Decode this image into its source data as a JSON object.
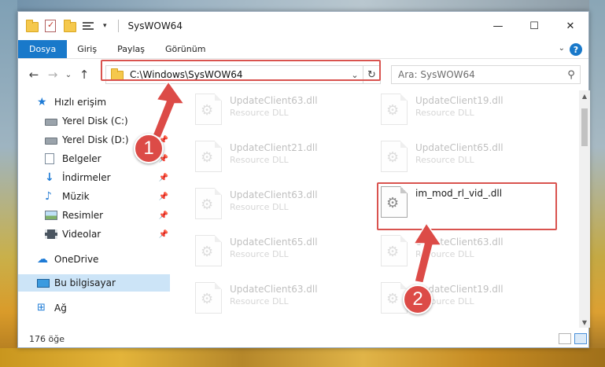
{
  "window": {
    "title": "SysWOW64",
    "controls": {
      "minimize": "—",
      "maximize": "☐",
      "close": "✕"
    }
  },
  "ribbon": {
    "tabs": [
      "Dosya",
      "Giriş",
      "Paylaş",
      "Görünüm"
    ],
    "help": "?",
    "collapse": "⌄"
  },
  "nav": {
    "back": "←",
    "forward": "→",
    "recent": "⌄",
    "up": "↑",
    "address": "C:\\Windows\\SysWOW64",
    "address_dropdown": "⌄",
    "refresh": "↻",
    "search_placeholder": "Ara: SysWOW64",
    "search_icon": "⚲"
  },
  "sidebar": {
    "items": [
      {
        "label": "Hızlı erişim",
        "icon": "star-icon",
        "pinned": false
      },
      {
        "label": "Yerel Disk (C:)",
        "icon": "drive-icon",
        "pinned": true
      },
      {
        "label": "Yerel Disk (D:)",
        "icon": "drive-icon",
        "pinned": true
      },
      {
        "label": "Belgeler",
        "icon": "documents-icon",
        "pinned": true
      },
      {
        "label": "İndirmeler",
        "icon": "downloads-icon",
        "pinned": true
      },
      {
        "label": "Müzik",
        "icon": "music-icon",
        "pinned": true
      },
      {
        "label": "Resimler",
        "icon": "pictures-icon",
        "pinned": true
      },
      {
        "label": "Videolar",
        "icon": "videos-icon",
        "pinned": true
      },
      {
        "label": "OneDrive",
        "icon": "onedrive-icon",
        "pinned": false
      },
      {
        "label": "Bu bilgisayar",
        "icon": "this-pc-icon",
        "pinned": false,
        "selected": true
      },
      {
        "label": "Ağ",
        "icon": "network-icon",
        "pinned": false
      }
    ],
    "pin_glyph": "📌"
  },
  "files": [
    {
      "name": "UpdateClient63.dll",
      "type": "Resource DLL",
      "faded": true
    },
    {
      "name": "UpdateClient19.dll",
      "type": "Resource DLL",
      "faded": true
    },
    {
      "name": "UpdateClient21.dll",
      "type": "Resource DLL",
      "faded": true
    },
    {
      "name": "UpdateClient65.dll",
      "type": "Resource DLL",
      "faded": true
    },
    {
      "name": "UpdateClient63.dll",
      "type": "Resource DLL",
      "faded": true
    },
    {
      "name": "im_mod_rl_vid_.dll",
      "type": "",
      "faded": false
    },
    {
      "name": "UpdateClient65.dll",
      "type": "Resource DLL",
      "faded": true
    },
    {
      "name": "UpdateClient63.dll",
      "type": "Resource DLL",
      "faded": true
    },
    {
      "name": "UpdateClient63.dll",
      "type": "Resource DLL",
      "faded": true
    },
    {
      "name": "UpdateClient19.dll",
      "type": "Resource DLL",
      "faded": true
    }
  ],
  "status": {
    "item_count": "176 öğe"
  },
  "annotations": {
    "badge1": "1",
    "badge2": "2",
    "color": "#dc4b47"
  }
}
